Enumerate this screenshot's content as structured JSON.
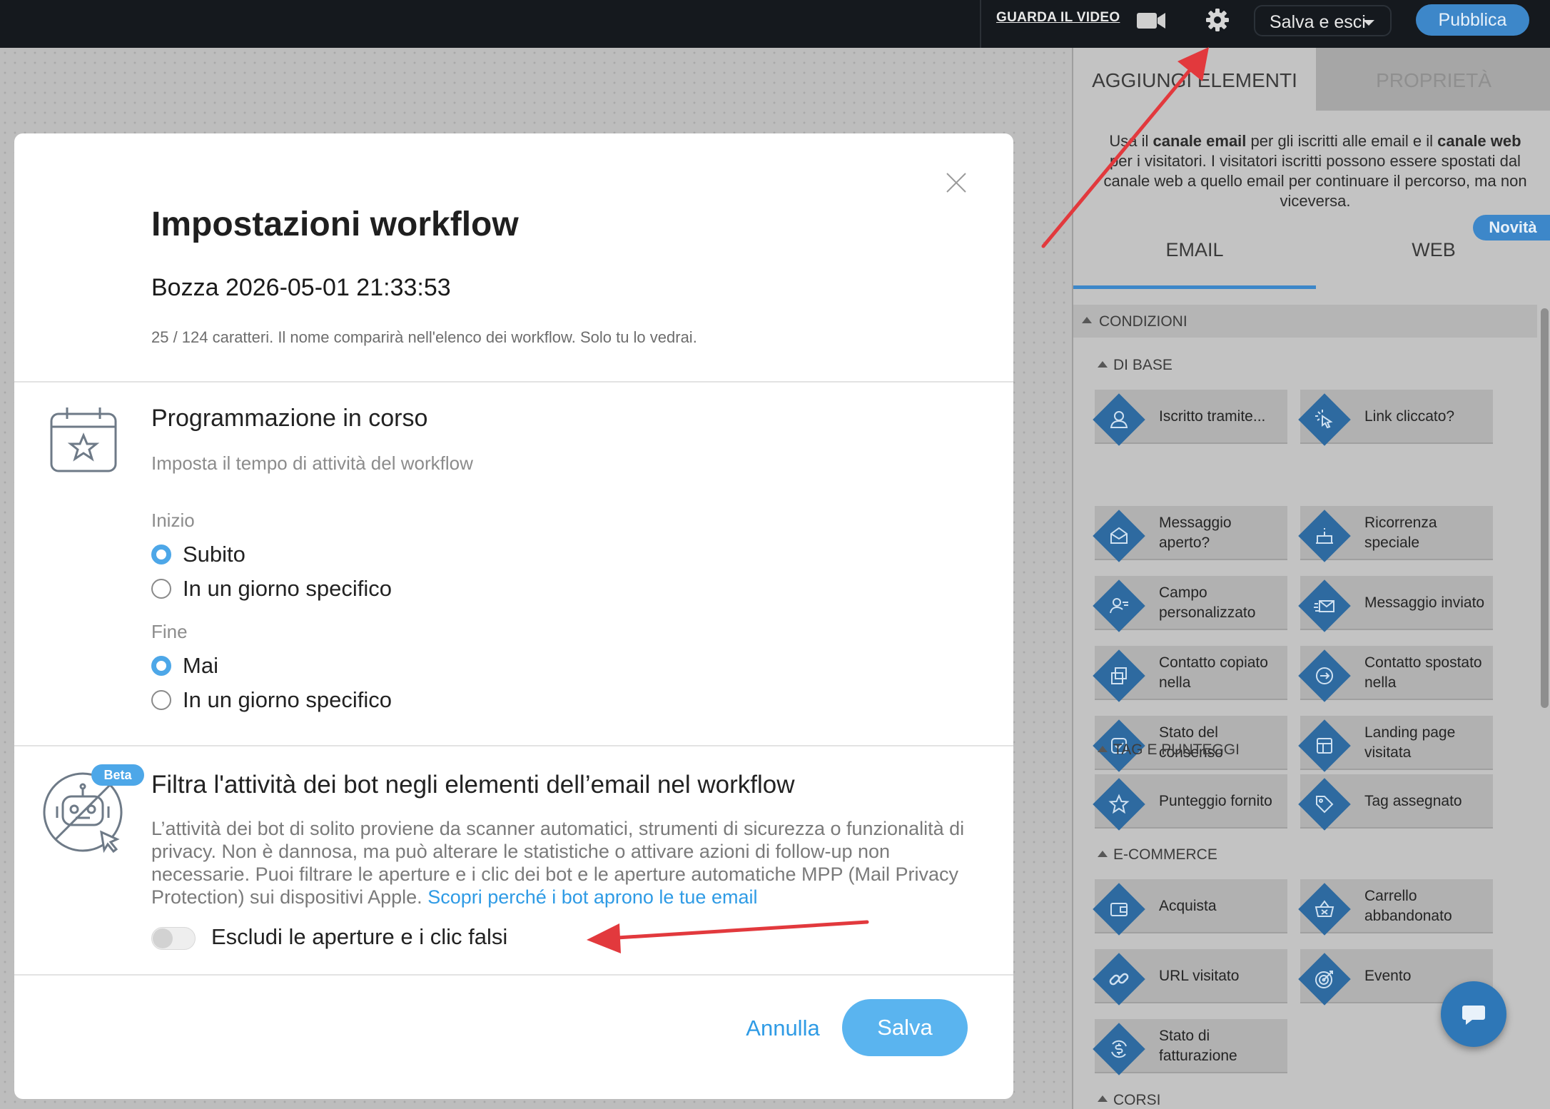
{
  "topbar": {
    "video_link": "GUARDA IL VIDEO",
    "save_exit": "Salva e esci",
    "publish": "Pubblica"
  },
  "panel": {
    "tab_add": "AGGIUNGI ELEMENTI",
    "tab_properties": "PROPRIETÀ",
    "intro": {
      "t1": "Usa il ",
      "b1": "canale email",
      "t2": " per gli iscritti alle email e il ",
      "b2": "canale web",
      "t3": " per i visitatori. I visitatori iscritti possono essere spostati dal canale web a quello email per continuare il percorso, ma non viceversa."
    },
    "badge_new": "Novità",
    "channel_email": "EMAIL",
    "channel_web": "WEB",
    "conditions_header": "CONDIZIONI",
    "groups": {
      "base": "DI BASE",
      "tags": "TAG E PUNTEGGI",
      "ecommerce": "E-COMMERCE",
      "courses": "CORSI"
    },
    "elements": {
      "iscritto": "Iscritto tramite...",
      "link": "Link cliccato?",
      "aperto": "Messaggio aperto?",
      "ricorrenza": "Ricorrenza speciale",
      "campo": "Campo personalizzato",
      "inviato": "Messaggio inviato",
      "copiato": "Contatto copiato nella",
      "spostato": "Contatto spostato nella",
      "consenso": "Stato del consenso",
      "landing": "Landing page visitata",
      "punteggio": "Punteggio fornito",
      "tag": "Tag assegnato",
      "acquista": "Acquista",
      "carrello": "Carrello abbandonato",
      "url": "URL visitato",
      "evento": "Evento",
      "fatturazione": "Stato di fatturazione"
    }
  },
  "modal": {
    "title": "Impostazioni workflow",
    "workflow_name": "Bozza 2026-05-01 21:33:53",
    "name_hint": "25 / 124 caratteri. Il nome comparirà nell'elenco dei workflow. Solo tu lo vedrai.",
    "schedule": {
      "title": "Programmazione in corso",
      "subtitle": "Imposta il tempo di attività del workflow",
      "start_label": "Inizio",
      "start_now": "Subito",
      "start_day": "In un giorno specifico",
      "end_label": "Fine",
      "end_never": "Mai",
      "end_day": "In un giorno specifico"
    },
    "bot": {
      "badge": "Beta",
      "title": "Filtra l'attività dei bot negli elementi dell’email nel workflow",
      "description": "L’attività dei bot di solito proviene da scanner automatici, strumenti di sicurezza o funzionalità di privacy. Non è dannosa, ma può alterare le statistiche o attivare azioni di follow-up non necessarie. Puoi filtrare le aperture e i clic dei bot e le aperture automatiche MPP (Mail Privacy Protection) sui dispositivi Apple. ",
      "link": "Scopri perché i bot aprono le tue email",
      "toggle_label": "Escludi le aperture e i clic falsi"
    },
    "cancel": "Annulla",
    "save": "Salva"
  }
}
